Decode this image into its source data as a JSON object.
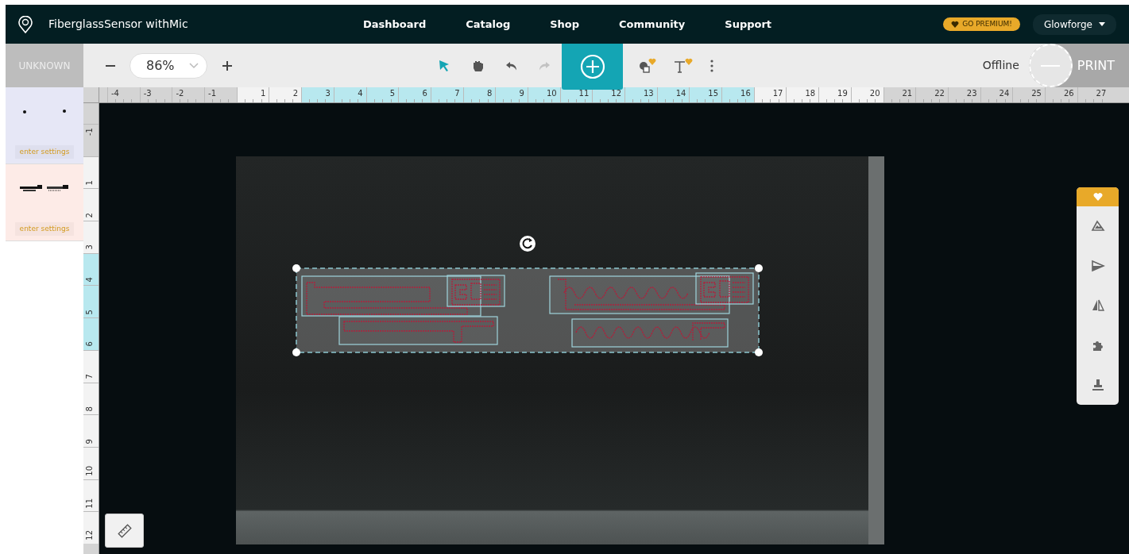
{
  "navbar": {
    "title": "FiberglassSensor withMic",
    "links": [
      "Dashboard",
      "Catalog",
      "Shop",
      "Community",
      "Support"
    ],
    "premium_badge": "GO PREMIUM!",
    "account": "Glowforge"
  },
  "toolbar": {
    "material": "UNKNOWN",
    "zoom": "86%",
    "modes": [
      {
        "kind": "select",
        "selected": true
      },
      {
        "kind": "pan",
        "selected": false
      }
    ],
    "history": [
      {
        "kind": "undo",
        "disabled": false
      },
      {
        "kind": "redo",
        "disabled": true
      }
    ],
    "add_tools": [
      {
        "kind": "shapes",
        "premium": true
      },
      {
        "kind": "text",
        "premium": true
      }
    ],
    "status": "Offline",
    "print": {
      "label": "PRINT",
      "disabled": true
    }
  },
  "operations": [
    {
      "kind": "dots",
      "color": "#e6e7f6",
      "action": "enter settings"
    },
    {
      "kind": "traces",
      "color": "#fdebe7",
      "action": "enter settings"
    }
  ],
  "ruler": {
    "horizontal": [
      {
        "label": "-4",
        "on_bed": false,
        "highlighted": false
      },
      {
        "label": "-3",
        "on_bed": false,
        "highlighted": false
      },
      {
        "label": "-2",
        "on_bed": false,
        "highlighted": false
      },
      {
        "label": "-1",
        "on_bed": false,
        "highlighted": false
      },
      {
        "label": "1",
        "on_bed": true,
        "highlighted": false
      },
      {
        "label": "2",
        "on_bed": true,
        "highlighted": false
      },
      {
        "label": "3",
        "on_bed": true,
        "highlighted": true
      },
      {
        "label": "4",
        "on_bed": true,
        "highlighted": true
      },
      {
        "label": "5",
        "on_bed": true,
        "highlighted": true
      },
      {
        "label": "6",
        "on_bed": true,
        "highlighted": true
      },
      {
        "label": "7",
        "on_bed": true,
        "highlighted": true
      },
      {
        "label": "8",
        "on_bed": true,
        "highlighted": true
      },
      {
        "label": "9",
        "on_bed": true,
        "highlighted": true
      },
      {
        "label": "10",
        "on_bed": true,
        "highlighted": true
      },
      {
        "label": "11",
        "on_bed": true,
        "highlighted": true
      },
      {
        "label": "12",
        "on_bed": true,
        "highlighted": true
      },
      {
        "label": "13",
        "on_bed": true,
        "highlighted": true
      },
      {
        "label": "14",
        "on_bed": true,
        "highlighted": true
      },
      {
        "label": "15",
        "on_bed": true,
        "highlighted": true
      },
      {
        "label": "16",
        "on_bed": true,
        "highlighted": true
      },
      {
        "label": "17",
        "on_bed": true,
        "highlighted": false
      },
      {
        "label": "18",
        "on_bed": true,
        "highlighted": false
      },
      {
        "label": "19",
        "on_bed": true,
        "highlighted": false
      },
      {
        "label": "20",
        "on_bed": true,
        "highlighted": false
      },
      {
        "label": "21",
        "on_bed": false,
        "highlighted": false
      },
      {
        "label": "22",
        "on_bed": false,
        "highlighted": false
      },
      {
        "label": "23",
        "on_bed": false,
        "highlighted": false
      },
      {
        "label": "24",
        "on_bed": false,
        "highlighted": false
      },
      {
        "label": "25",
        "on_bed": false,
        "highlighted": false
      },
      {
        "label": "26",
        "on_bed": false,
        "highlighted": false
      },
      {
        "label": "27",
        "on_bed": false,
        "highlighted": false
      }
    ],
    "vertical": [
      {
        "label": "-1",
        "on_bed": false,
        "highlighted": false
      },
      {
        "label": "1",
        "on_bed": true,
        "highlighted": false
      },
      {
        "label": "2",
        "on_bed": true,
        "highlighted": false
      },
      {
        "label": "3",
        "on_bed": true,
        "highlighted": false
      },
      {
        "label": "4",
        "on_bed": true,
        "highlighted": true
      },
      {
        "label": "5",
        "on_bed": true,
        "highlighted": true
      },
      {
        "label": "6",
        "on_bed": true,
        "highlighted": true
      },
      {
        "label": "7",
        "on_bed": true,
        "highlighted": false
      },
      {
        "label": "8",
        "on_bed": true,
        "highlighted": false
      },
      {
        "label": "9",
        "on_bed": true,
        "highlighted": false
      },
      {
        "label": "10",
        "on_bed": true,
        "highlighted": false
      },
      {
        "label": "11",
        "on_bed": true,
        "highlighted": false
      },
      {
        "label": "12",
        "on_bed": true,
        "highlighted": false
      }
    ]
  },
  "side_tools": [
    {
      "kind": "premium"
    },
    {
      "kind": "engrave"
    },
    {
      "kind": "skew"
    },
    {
      "kind": "mirror"
    },
    {
      "kind": "puzzle"
    },
    {
      "kind": "stamp"
    }
  ]
}
